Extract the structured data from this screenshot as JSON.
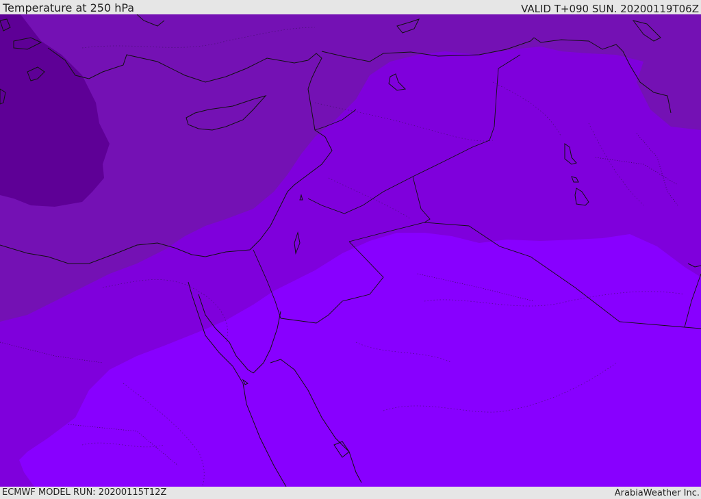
{
  "header": {
    "title": "Temperature at 250 hPa",
    "valid_time": "VALID T+090 SUN. 20200119T06Z"
  },
  "footer": {
    "model_run": "ECMWF MODEL RUN: 20200115T12Z",
    "credit": "ArabiaWeather Inc."
  },
  "map": {
    "variable": "temperature",
    "level": "250 hPa",
    "region": "Eastern Mediterranean / Levant / Arabian Peninsula",
    "colors": {
      "coldest": "#5e0096",
      "cold": "#7411b4",
      "mid": "#7f00dc",
      "warm": "#8800ff",
      "borders": "#111111"
    }
  }
}
